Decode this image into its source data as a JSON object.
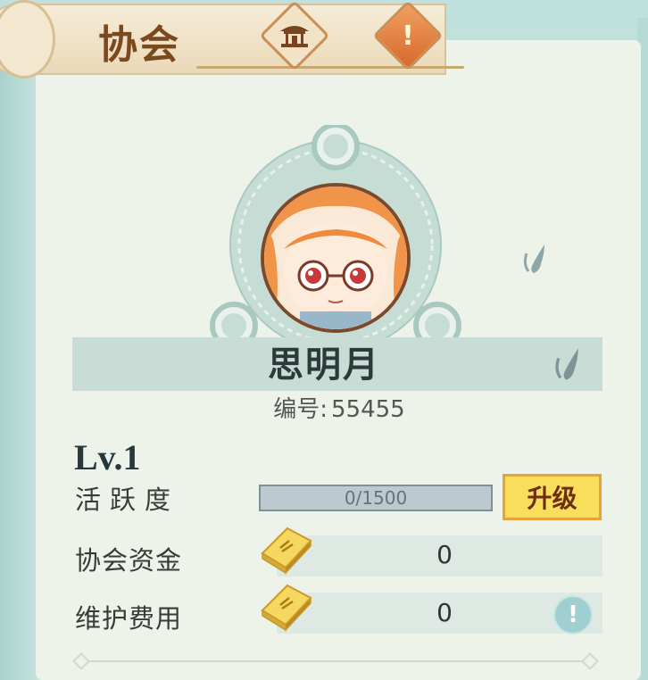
{
  "header": {
    "title": "协会",
    "home_icon": "pavilion-icon",
    "alert_icon": "exclamation-icon",
    "alert_glyph": "!"
  },
  "profile": {
    "name": "思明月",
    "id_label": "编号:",
    "id_value": "55455",
    "edit_icon": "brush-edit-icon"
  },
  "stats": {
    "level": "Lv.1",
    "activity_label": "活跃度",
    "activity_current": "0",
    "activity_max": "/1500",
    "activity_progress": 0,
    "upgrade_label": "升级",
    "funds_label": "协会资金",
    "funds_value": "0",
    "fee_label": "维护费用",
    "fee_value": "0",
    "info_glyph": "!"
  },
  "colors": {
    "panel": "#eef3ea",
    "upgrade_button": "#f8de5a",
    "title_brown": "#7a4a1e",
    "emblem_teal": "#c8ddd6"
  }
}
